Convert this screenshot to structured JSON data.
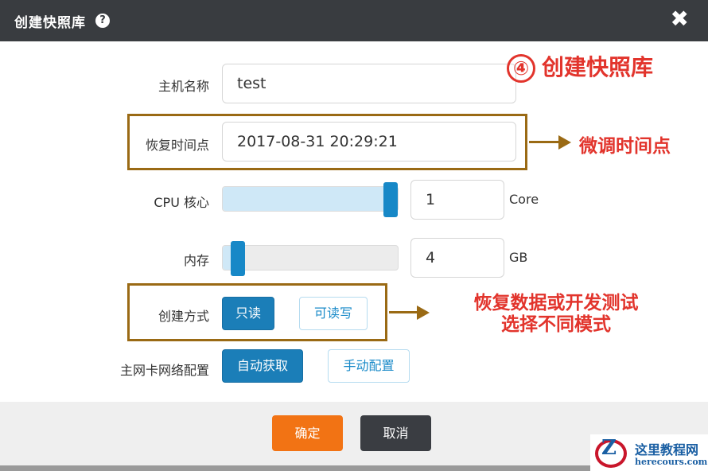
{
  "dialog": {
    "title": "创建快照库",
    "help_icon": "?",
    "close_icon": "✖"
  },
  "form": {
    "host_name": {
      "label": "主机名称",
      "value": "test"
    },
    "restore_time": {
      "label": "恢复时间点",
      "value": "2017-08-31 20:29:21"
    },
    "cpu": {
      "label": "CPU 核心",
      "value": "1",
      "unit": "Core",
      "slider_level": 1.0
    },
    "memory": {
      "label": "内存",
      "value": "4",
      "unit": "GB",
      "slider_level": 0.05
    },
    "create_mode": {
      "label": "创建方式",
      "options": [
        "只读",
        "可读写"
      ],
      "selected": "只读"
    },
    "nic_config": {
      "label": "主网卡网络配置",
      "options": [
        "自动获取",
        "手动配置"
      ],
      "selected": "自动获取"
    }
  },
  "footer": {
    "confirm_label": "确定",
    "cancel_label": "取消"
  },
  "annotations": {
    "step_number": "④",
    "step_title": "创建快照库",
    "restore_note": "微调时间点",
    "mode_note_line1": "恢复数据或开发测试",
    "mode_note_line2": "选择不同模式"
  },
  "watermark": {
    "logo_letter": "Z",
    "name": "这里教程网",
    "site": "herecours.com"
  },
  "colors": {
    "titlebar": "#393c40",
    "primary": "#1b7eb8",
    "confirm": "#f27314",
    "cancel": "#3a3d42",
    "annotation_red": "#e2342c",
    "annotation_box": "#9a6a14"
  }
}
